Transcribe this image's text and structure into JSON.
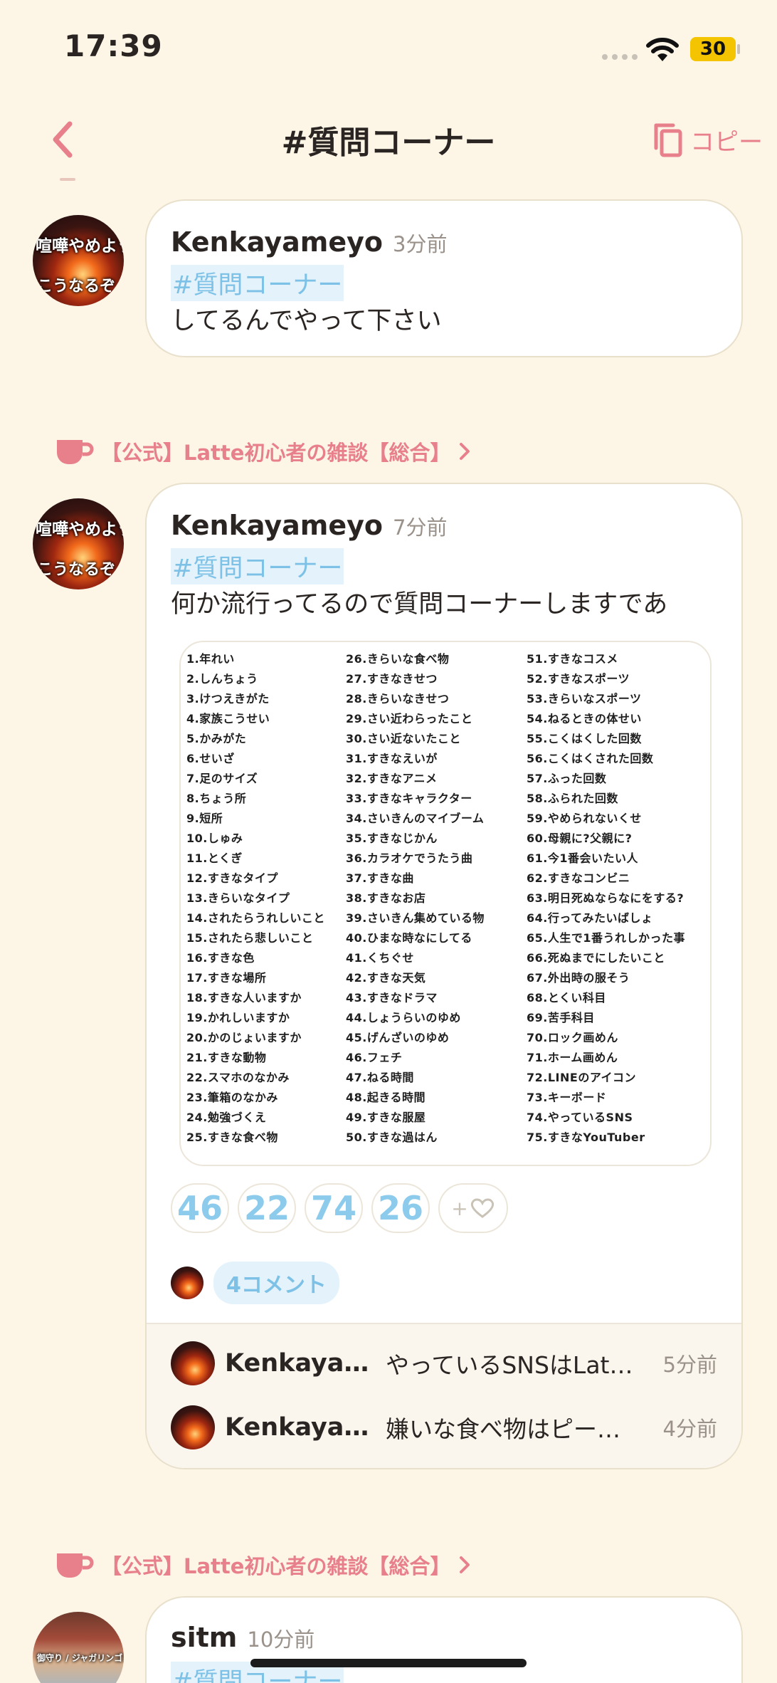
{
  "status_bar": {
    "time": "17:39",
    "battery": "30"
  },
  "nav": {
    "title": "#質問コーナー",
    "copy_label": "コピー"
  },
  "posts": [
    {
      "author": "Kenkayameyo",
      "time": "3分前",
      "hashtag": "#質問コーナー",
      "text": "してるんでやって下さい",
      "avatar_text_top": "喧嘩やめよう",
      "avatar_text_bottom": "こうなるぞ"
    },
    {
      "community": "【公式】Latte初心者の雑談【総合】",
      "author": "Kenkayameyo",
      "time": "7分前",
      "hashtag": "#質問コーナー",
      "text": "何か流行ってるので質問コーナーしますであ",
      "avatar_text_top": "喧嘩やめよう",
      "avatar_text_bottom": "こうなるぞ",
      "questions": [
        "1.年れい",
        "2.しんちょう",
        "3.けつえきがた",
        "4.家族こうせい",
        "5.かみがた",
        "6.せいざ",
        "7.足のサイズ",
        "8.ちょう所",
        "9.短所",
        "10.しゅみ",
        "11.とくぎ",
        "12.すきなタイプ",
        "13.きらいなタイプ",
        "14.されたらうれしいこと",
        "15.されたら悲しいこと",
        "16.すきな色",
        "17.すきな場所",
        "18.すきな人いますか",
        "19.かれしいますか",
        "20.かのじょいますか",
        "21.すきな動物",
        "22.スマホのなかみ",
        "23.筆箱のなかみ",
        "24.勉強づくえ",
        "25.すきな食べ物",
        "26.きらいな食べ物",
        "27.すきなきせつ",
        "28.きらいなきせつ",
        "29.さい近わらったこと",
        "30.さい近ないたこと",
        "31.すきなえいが",
        "32.すきなアニメ",
        "33.すきなキャラクター",
        "34.さいきんのマイブーム",
        "35.すきなじかん",
        "36.カラオケでうたう曲",
        "37.すきな曲",
        "38.すきなお店",
        "39.さいきん集めている物",
        "40.ひまな時なにしてる",
        "41.くちぐせ",
        "42.すきな天気",
        "43.すきなドラマ",
        "44.しょうらいのゆめ",
        "45.げんざいのゆめ",
        "46.フェチ",
        "47.ねる時間",
        "48.起きる時間",
        "49.すきな服屋",
        "50.すきな過はん",
        "51.すきなコスメ",
        "52.すきなスポーツ",
        "53.きらいなスポーツ",
        "54.ねるときの体せい",
        "55.こくはくした回数",
        "56.こくはくされた回数",
        "57.ふった回数",
        "58.ふられた回数",
        "59.やめられないくせ",
        "60.母親に?父親に?",
        "61.今1番会いたい人",
        "62.すきなコンビニ",
        "63.明日死ぬならなにをする?",
        "64.行ってみたいばしょ",
        "65.人生で1番うれしかった事",
        "66.死ぬまでにしたいこと",
        "67.外出時の服そう",
        "68.とくい科目",
        "69.苦手科目",
        "70.ロック画めん",
        "71.ホーム画めん",
        "72.LINEのアイコン",
        "73.キーボード",
        "74.やっているSNS",
        "75.すきなYouTuber"
      ],
      "reactions": [
        "46",
        "22",
        "74",
        "26"
      ],
      "add_reaction": "+",
      "comment_count": "4コメント",
      "comments": [
        {
          "author": "Kenkayameyo",
          "text": "やっているSNSはLatteです",
          "time": "5分前"
        },
        {
          "author": "Kenkayameyo",
          "text": "嫌いな食べ物はピーマンです",
          "time": "4分前"
        }
      ]
    },
    {
      "community": "【公式】Latte初心者の雑談【総合】",
      "author": "sitm",
      "time": "10分前",
      "hashtag": "#質問コーナー",
      "avatar_text": "御守り / ジャガリンゴン"
    }
  ]
}
